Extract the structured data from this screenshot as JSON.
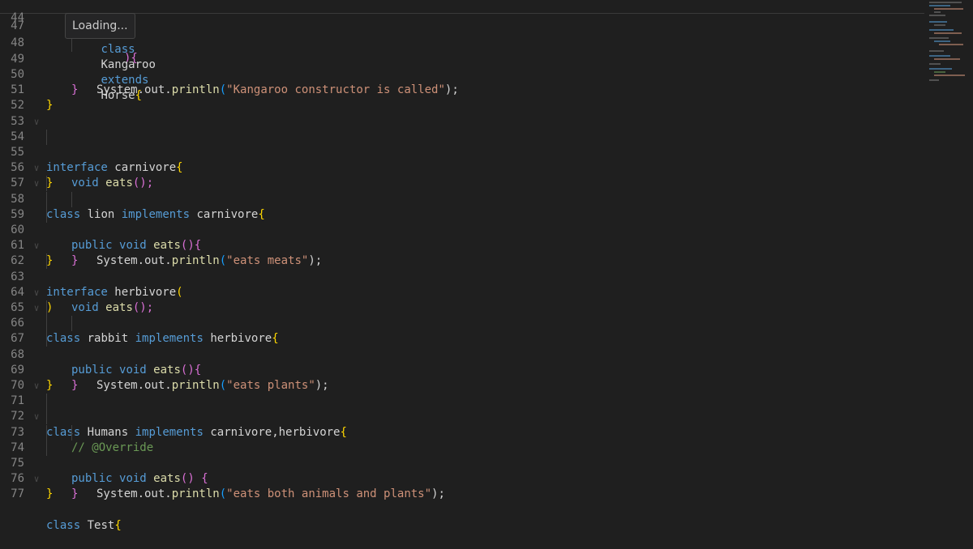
{
  "tooltip": {
    "text": "Loading..."
  },
  "sticky": {
    "line_number": "44",
    "kw_class": "class",
    "name": "Kangaroo",
    "kw_extends": "extends",
    "parent": "Horse",
    "brace": "{"
  },
  "lines": [
    {
      "n": "47"
    },
    {
      "n": "48"
    },
    {
      "n": "49",
      "a": "System.out.",
      "fn": "println",
      "p1": "(",
      "str": "\"Kangaroo constructor is called\"",
      "p2": ");"
    },
    {
      "n": "50",
      "brace": "}"
    },
    {
      "n": "51",
      "brace": "}"
    },
    {
      "n": "52"
    },
    {
      "n": "53"
    },
    {
      "n": "54",
      "kw": "interface",
      "name": "carnivore",
      "brace": "{"
    },
    {
      "n": "55",
      "kw": "void",
      "fn": "eats",
      "p": "();"
    },
    {
      "n": "56",
      "brace": "}"
    },
    {
      "n": "57",
      "kw": "class",
      "name": "lion",
      "kw2": "implements",
      "name2": "carnivore",
      "brace": "{"
    },
    {
      "n": "58",
      "kw": "public",
      "kw2": "void",
      "fn": "eats",
      "p": "()",
      "brace": "{"
    },
    {
      "n": "59",
      "a": "System.out.",
      "fn": "println",
      "p1": "(",
      "str": "\"eats meats\"",
      "p2": ");"
    },
    {
      "n": "60",
      "brace": "}"
    },
    {
      "n": "61",
      "brace": "}"
    },
    {
      "n": "62",
      "kw": "interface",
      "name": "herbivore",
      "brace": "("
    },
    {
      "n": "63",
      "kw": "void",
      "fn": "eats",
      "p": "();"
    },
    {
      "n": "64",
      "brace": ")"
    },
    {
      "n": "65",
      "kw": "class",
      "name": "rabbit",
      "kw2": "implements",
      "name2": "herbivore",
      "brace": "{"
    },
    {
      "n": "66",
      "kw": "public",
      "kw2": "void",
      "fn": "eats",
      "p": "()",
      "brace": "{"
    },
    {
      "n": "67",
      "a": "System.out.",
      "fn": "println",
      "p1": "(",
      "str": "\"eats plants\"",
      "p2": ");"
    },
    {
      "n": "68",
      "brace": "}"
    },
    {
      "n": "69",
      "brace": "}"
    },
    {
      "n": "70"
    },
    {
      "n": "71",
      "kw": "class",
      "name": "Humans",
      "kw2": "implements",
      "name2": "carnivore,herbivore",
      "brace": "{"
    },
    {
      "n": "72",
      "comment": "// @Override"
    },
    {
      "n": "73",
      "kw": "public",
      "kw2": "void",
      "fn": "eats",
      "p": "() ",
      "brace": "{"
    },
    {
      "n": "74",
      "a": "System.out.",
      "fn": "println",
      "p1": "(",
      "str": "\"eats both animals and plants\"",
      "p2": ");"
    },
    {
      "n": "75",
      "brace": "}"
    },
    {
      "n": "76",
      "brace": "}"
    },
    {
      "n": "77",
      "kw": "class",
      "name": "Test",
      "brace": "{"
    }
  ],
  "line48_tail": "){",
  "colors": {
    "background": "#1f1f1f",
    "keyword": "#569cd6",
    "string": "#ce9178",
    "function": "#dcdcaa",
    "comment": "#6a9955",
    "bracket_gold": "#ffd700",
    "bracket_orchid": "#da70d6",
    "line_number": "#858585"
  }
}
